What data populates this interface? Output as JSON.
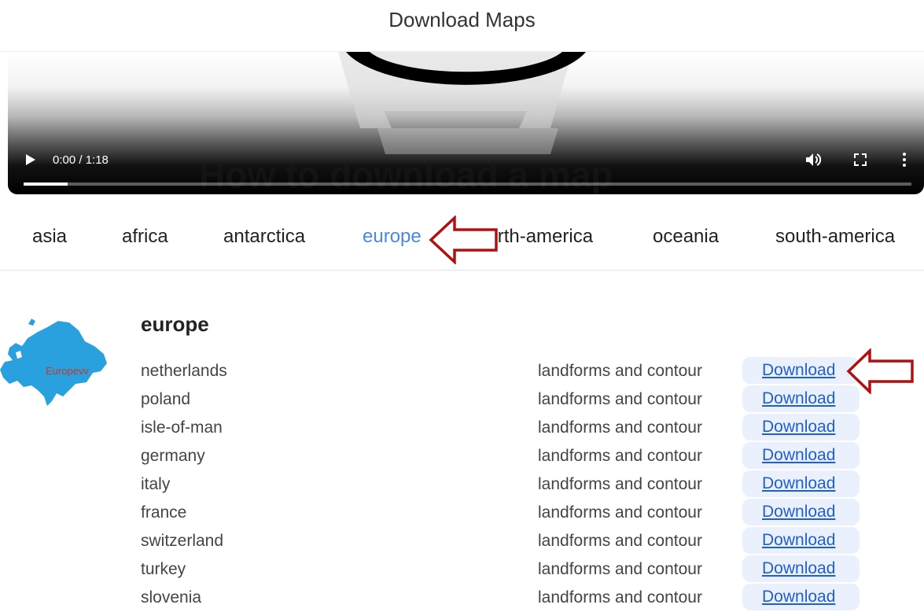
{
  "page": {
    "title": "Download Maps"
  },
  "video": {
    "time": "0:00 / 1:18",
    "progress_fraction": 0.05,
    "overlay_text": "How to download a map",
    "icons": [
      "play-icon",
      "volume-icon",
      "fullscreen-icon",
      "more-options-icon"
    ]
  },
  "tabs": [
    {
      "label": "asia",
      "active": false
    },
    {
      "label": "africa",
      "active": false
    },
    {
      "label": "antarctica",
      "active": false
    },
    {
      "label": "europe",
      "active": true
    },
    {
      "label": "north-america",
      "active": false
    },
    {
      "label": "oceania",
      "active": false
    },
    {
      "label": "south-america",
      "active": false
    }
  ],
  "section": {
    "title": "europe",
    "map_label": "Europevv",
    "rows": [
      {
        "country": "netherlands",
        "description": "landforms and contour",
        "link": "Download"
      },
      {
        "country": "poland",
        "description": "landforms and contour",
        "link": "Download"
      },
      {
        "country": "isle-of-man",
        "description": "landforms and contour",
        "link": "Download"
      },
      {
        "country": "germany",
        "description": "landforms and contour",
        "link": "Download"
      },
      {
        "country": "italy",
        "description": "landforms and contour",
        "link": "Download"
      },
      {
        "country": "france",
        "description": "landforms and contour",
        "link": "Download"
      },
      {
        "country": "switzerland",
        "description": "landforms and contour",
        "link": "Download"
      },
      {
        "country": "turkey",
        "description": "landforms and contour",
        "link": "Download"
      },
      {
        "country": "slovenia",
        "description": "landforms and contour",
        "link": "Download"
      }
    ]
  },
  "colors": {
    "active_tab": "#4a88e8",
    "link": "#1f5fd1",
    "download_bg": "#eaf1fc",
    "arrow": "#b01010",
    "map_fill": "#2aa1df",
    "map_label": "#c0392b"
  }
}
